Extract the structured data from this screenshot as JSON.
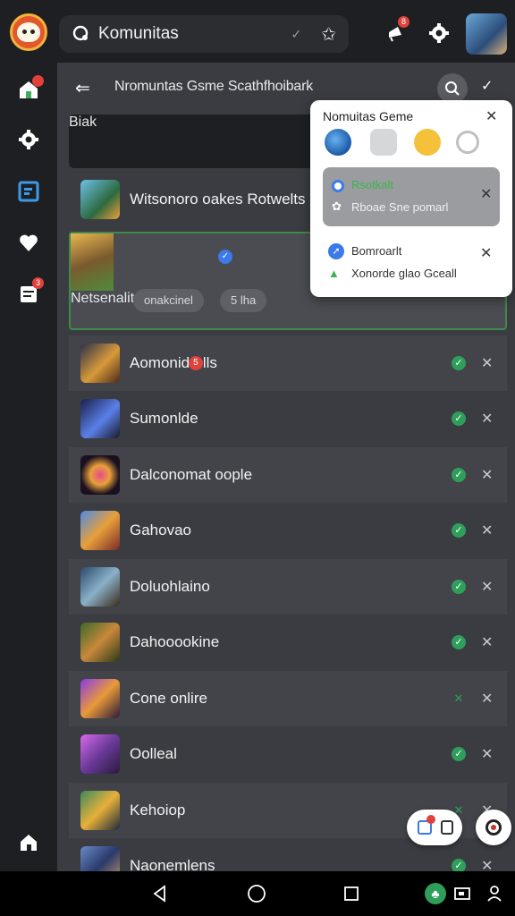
{
  "colors": {
    "accent_green": "#2f9e5b",
    "badge_red": "#e0413a",
    "selection_border": "#3f8a4d"
  },
  "top_bar": {
    "title": "Komunitas",
    "badges": {
      "notifications": "8"
    },
    "icons": [
      "app-logo",
      "community-icon",
      "checkmark-icon",
      "star-icon",
      "megaphone-icon",
      "gear-icon",
      "user-avatar"
    ]
  },
  "rail": {
    "badges": {
      "notes": "3"
    }
  },
  "header": {
    "title": "Nromuntas Gsme Scathfhoibark"
  },
  "pinned": [
    {
      "name": "Biak"
    },
    {
      "name": "Witsonoro oakes Rotwelts"
    }
  ],
  "selected": {
    "name": "Netsenalite",
    "chips": [
      "onakcinel",
      "5 lha"
    ]
  },
  "rows": [
    {
      "name": "Aomonid",
      "suffix": "lls",
      "status": "check"
    },
    {
      "name": "Sumonlde",
      "status": "check"
    },
    {
      "name": "Dalconomat oople",
      "status": "check"
    },
    {
      "name": "Gahovao",
      "status": "check"
    },
    {
      "name": "Doluohlaino",
      "status": "check"
    },
    {
      "name": "Dahooookine",
      "status": "check"
    },
    {
      "name": "Cone onlire",
      "status": "mark"
    },
    {
      "name": "Oolleal",
      "status": "check"
    },
    {
      "name": "Kehoiop",
      "status": "mark"
    },
    {
      "name": "Naonemlens",
      "status": "check"
    }
  ],
  "popup": {
    "title": "Nomuitas Geme",
    "item1": {
      "line1": "Rsotkalt",
      "line2": "Rboae Sne pomarl"
    },
    "item2": {
      "line1": "Bomroarlt",
      "line2": "Xonorde glao Gceall"
    }
  },
  "row_suffix_badge": "5"
}
